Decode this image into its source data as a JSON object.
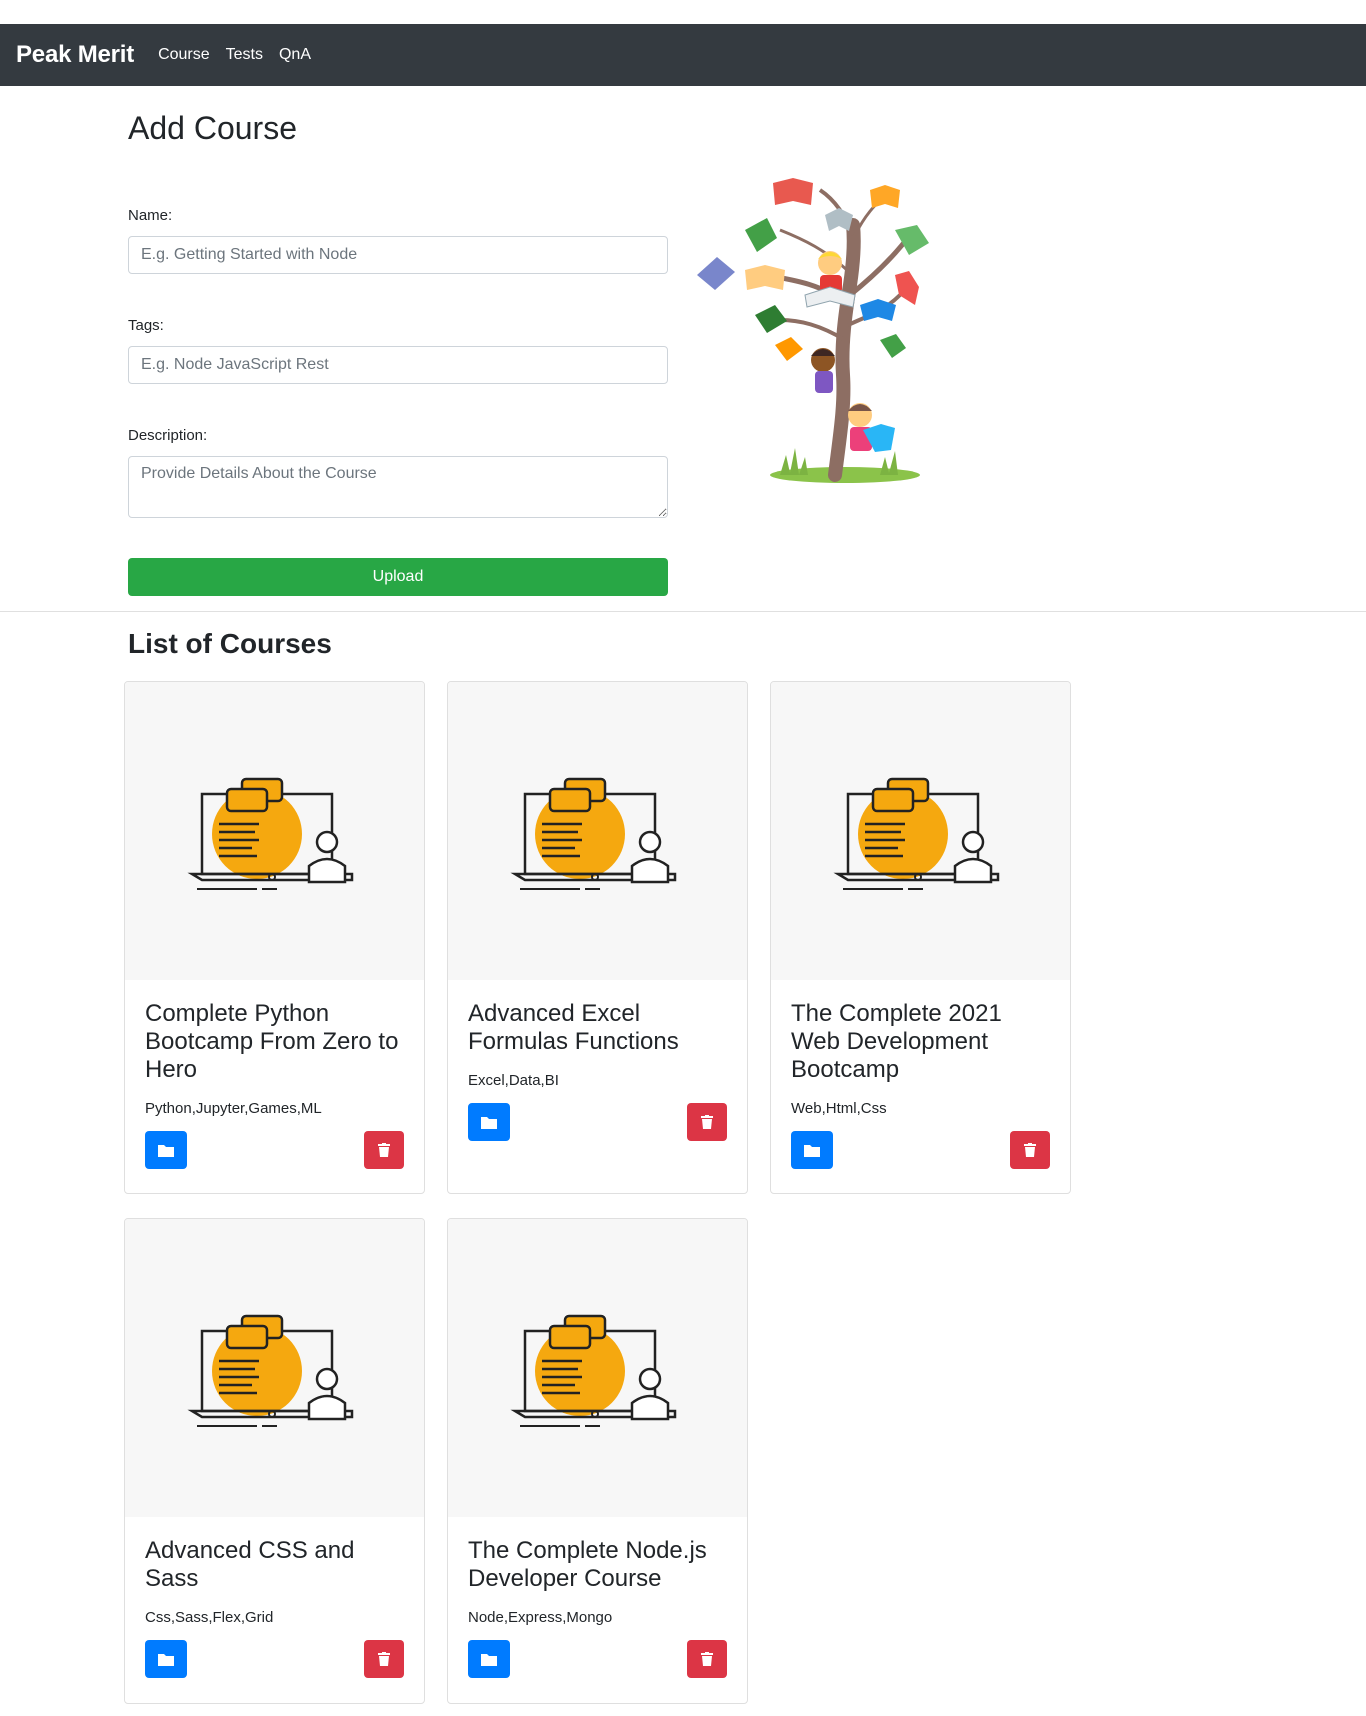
{
  "navbar": {
    "brand": "Peak Merit",
    "links": [
      "Course",
      "Tests",
      "QnA"
    ]
  },
  "add_course": {
    "title": "Add Course",
    "name_label": "Name:",
    "name_placeholder": "E.g. Getting Started with Node",
    "tags_label": "Tags:",
    "tags_placeholder": "E.g. Node JavaScript Rest",
    "description_label": "Description:",
    "description_placeholder": "Provide Details About the Course",
    "upload_label": "Upload"
  },
  "list": {
    "title": "List of Courses",
    "courses": [
      {
        "title": "Complete Python Bootcamp From Zero to Hero",
        "tags": "Python,Jupyter,Games,ML"
      },
      {
        "title": "Advanced Excel Formulas Functions",
        "tags": "Excel,Data,BI"
      },
      {
        "title": "The Complete 2021 Web Development Bootcamp",
        "tags": "Web,Html,Css"
      },
      {
        "title": "Advanced CSS and Sass",
        "tags": "Css,Sass,Flex,Grid"
      },
      {
        "title": "The Complete Node.js Developer Course",
        "tags": "Node,Express,Mongo"
      }
    ]
  },
  "icons": {
    "open": "folder-icon",
    "delete": "trash-icon"
  },
  "colors": {
    "navbar": "#343a40",
    "upload": "#28a745",
    "open_button": "#007bff",
    "delete_button": "#dc3545",
    "illustration_accent": "#f5a80f"
  }
}
